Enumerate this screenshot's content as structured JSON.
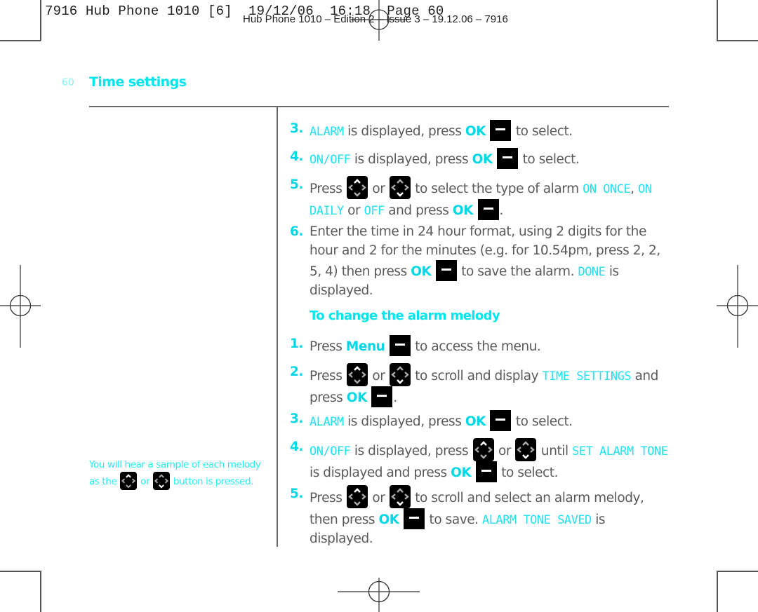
{
  "header": {
    "slug": "7916 Hub Phone 1010 [6]  19/12/06  16:18  Page 60",
    "sub_slug": "Hub Phone 1010 – Edition 2 – Issue 3 – 19.12.06 – 7916"
  },
  "page": {
    "number": "60",
    "section_title": "Time settings"
  },
  "icons": {
    "ok_softkey": "softkey-minus-icon",
    "nav_up": "nav-up-icon",
    "nav_down": "nav-down-icon"
  },
  "words": {
    "or": "or",
    "ok": "OK",
    "menu": "Menu",
    "press": "Press",
    "press_lc": "press",
    "period": "."
  },
  "steps_a": [
    {
      "num": "3.",
      "lcd": "ALARM",
      "text_a": " is displayed, press ",
      "text_b": " to select."
    },
    {
      "num": "4.",
      "lcd": "ON/OFF",
      "text_a": " is displayed, press ",
      "text_b": " to select."
    },
    {
      "num": "5.",
      "text_a": " to select the type of alarm ",
      "lcd_a": "ON ONCE",
      "sep": ", ",
      "lcd_b": "ON DAILY",
      "text_b": " or ",
      "lcd_c": "OFF",
      "text_c": " and press "
    },
    {
      "num": "6.",
      "text_a": "Enter the time in 24 hour format, using 2 digits for the hour and 2 for the minutes (e.g. for 10.54pm, press 2, 2, 5, 4) then press ",
      "text_b": " to save the alarm. ",
      "lcd": "DONE",
      "text_c": " is displayed."
    }
  ],
  "subsection": {
    "title": "To change the alarm melody"
  },
  "steps_b": [
    {
      "num": "1.",
      "text_b": " to access the menu."
    },
    {
      "num": "2.",
      "text_a": " to scroll and display ",
      "lcd": "TIME SETTINGS",
      "text_b": " and "
    },
    {
      "num": "3.",
      "lcd": "ALARM",
      "text_a": " is displayed, press ",
      "text_b": " to select."
    },
    {
      "num": "4.",
      "lcd_a": "ON/OFF",
      "text_a": " is displayed, press ",
      "text_b": " until ",
      "lcd_b": "SET ALARM TONE",
      "text_c": " is displayed and press ",
      "text_d": " to select."
    },
    {
      "num": "5.",
      "text_a": " to scroll and select an alarm melody, then ",
      "text_b": " to save. ",
      "lcd": "ALARM TONE SAVED",
      "text_c": " is displayed."
    }
  ],
  "note": {
    "text_a": "You will hear a sample of each melody as the ",
    "text_b": " button is pressed."
  },
  "colors": {
    "accent": "#00e5ee",
    "lcd_text": "#22e0f0",
    "body_text": "#5a5a5a"
  }
}
